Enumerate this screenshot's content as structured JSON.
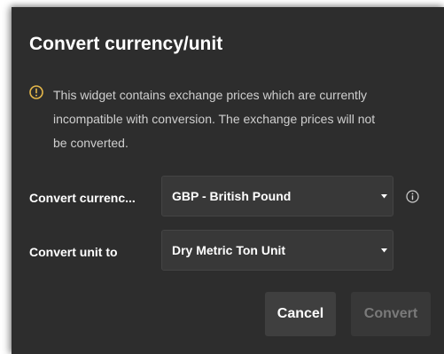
{
  "dialog": {
    "title": "Convert currency/unit",
    "warning": {
      "icon": "warning-circle-icon",
      "icon_color": "#e6b84a",
      "lines": [
        "This widget contains exchange prices which are currently",
        "incompatible with conversion. The exchange prices will not",
        "be converted."
      ]
    },
    "currency_row": {
      "label": "Convert currenc...",
      "selected": "GBP - British Pound",
      "info_icon": "info-circle-icon"
    },
    "unit_row": {
      "label": "Convert unit to",
      "selected": "Dry Metric Ton Unit"
    },
    "buttons": {
      "cancel": "Cancel",
      "convert": "Convert"
    }
  },
  "colors": {
    "dialog_bg": "#2d2d2d",
    "select_bg": "#383838",
    "text": "#ffffff",
    "muted_text": "#cfcfcf",
    "disabled_text": "#7a7a7a",
    "warning": "#e6b84a"
  }
}
